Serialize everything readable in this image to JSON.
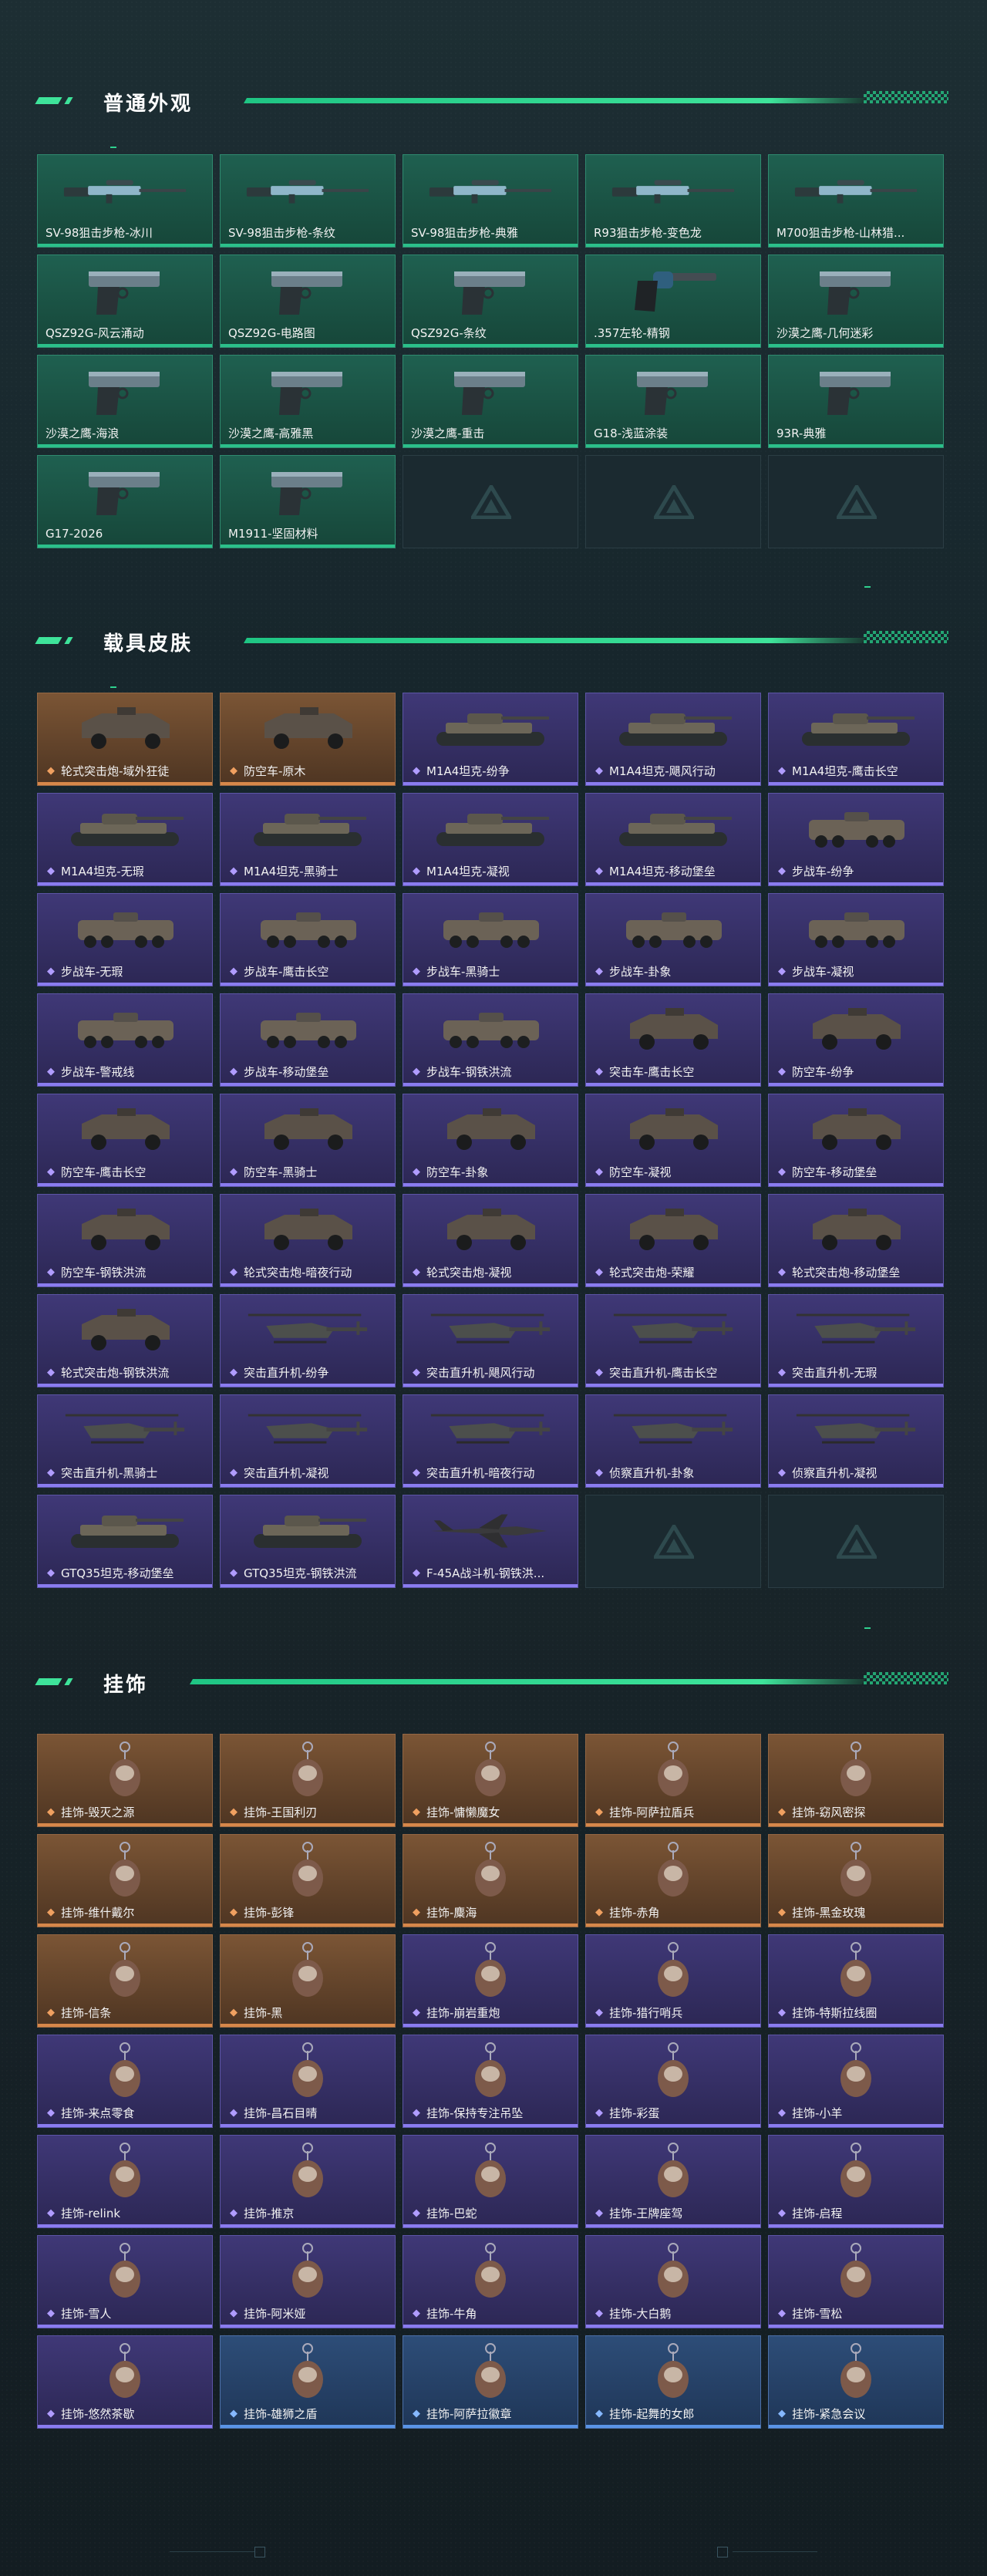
{
  "colors": {
    "green": "#2bc08a",
    "orange": "#d7874a",
    "purple": "#8a7cf0",
    "blue": "#5a94e6",
    "accent": "#3ee39a"
  },
  "sections": [
    {
      "title": "普通外观",
      "items": [
        {
          "label": "SV-98狙击步枪-冰川",
          "tier": "green",
          "icon": "sniper-rifle-icon"
        },
        {
          "label": "SV-98狙击步枪-条纹",
          "tier": "green",
          "icon": "sniper-rifle-icon"
        },
        {
          "label": "SV-98狙击步枪-典雅",
          "tier": "green",
          "icon": "sniper-rifle-icon"
        },
        {
          "label": "R93狙击步枪-变色龙",
          "tier": "green",
          "icon": "sniper-rifle-icon"
        },
        {
          "label": "M700狙击步枪-山林猎...",
          "tier": "green",
          "icon": "sniper-rifle-icon"
        },
        {
          "label": "QSZ92G-风云涌动",
          "tier": "green",
          "icon": "pistol-icon"
        },
        {
          "label": "QSZ92G-电路图",
          "tier": "green",
          "icon": "pistol-icon"
        },
        {
          "label": "QSZ92G-条纹",
          "tier": "green",
          "icon": "pistol-icon"
        },
        {
          "label": ".357左轮-精钢",
          "tier": "green",
          "icon": "revolver-icon"
        },
        {
          "label": "沙漠之鹰-几何迷彩",
          "tier": "green",
          "icon": "pistol-icon"
        },
        {
          "label": "沙漠之鹰-海浪",
          "tier": "green",
          "icon": "pistol-icon"
        },
        {
          "label": "沙漠之鹰-高雅黑",
          "tier": "green",
          "icon": "pistol-icon"
        },
        {
          "label": "沙漠之鹰-重击",
          "tier": "green",
          "icon": "pistol-icon"
        },
        {
          "label": "G18-浅蓝涂装",
          "tier": "green",
          "icon": "pistol-icon"
        },
        {
          "label": "93R-典雅",
          "tier": "green",
          "icon": "pistol-icon"
        },
        {
          "label": "G17-2026",
          "tier": "green",
          "icon": "pistol-icon"
        },
        {
          "label": "M1911-坚固材料",
          "tier": "green",
          "icon": "pistol-icon"
        },
        {
          "label": "",
          "tier": "empty",
          "icon": "empty-slot-logo-icon"
        },
        {
          "label": "",
          "tier": "empty",
          "icon": "empty-slot-logo-icon"
        },
        {
          "label": "",
          "tier": "empty",
          "icon": "empty-slot-logo-icon"
        }
      ]
    },
    {
      "title": "载具皮肤",
      "items": [
        {
          "label": "轮式突击炮-域外狂徒",
          "tier": "orange",
          "icon": "armored-car-icon"
        },
        {
          "label": "防空车-原木",
          "tier": "orange",
          "icon": "armored-car-icon"
        },
        {
          "label": "M1A4坦克-纷争",
          "tier": "purple",
          "icon": "tank-icon"
        },
        {
          "label": "M1A4坦克-飓风行动",
          "tier": "purple",
          "icon": "tank-icon"
        },
        {
          "label": "M1A4坦克-鹰击长空",
          "tier": "purple",
          "icon": "tank-icon"
        },
        {
          "label": "M1A4坦克-无瑕",
          "tier": "purple",
          "icon": "tank-icon"
        },
        {
          "label": "M1A4坦克-黑骑士",
          "tier": "purple",
          "icon": "tank-icon"
        },
        {
          "label": "M1A4坦克-凝视",
          "tier": "purple",
          "icon": "tank-icon"
        },
        {
          "label": "M1A4坦克-移动堡垒",
          "tier": "purple",
          "icon": "tank-icon"
        },
        {
          "label": "步战车-纷争",
          "tier": "purple",
          "icon": "ifv-icon"
        },
        {
          "label": "步战车-无瑕",
          "tier": "purple",
          "icon": "ifv-icon"
        },
        {
          "label": "步战车-鹰击长空",
          "tier": "purple",
          "icon": "ifv-icon"
        },
        {
          "label": "步战车-黑骑士",
          "tier": "purple",
          "icon": "ifv-icon"
        },
        {
          "label": "步战车-卦象",
          "tier": "purple",
          "icon": "ifv-icon"
        },
        {
          "label": "步战车-凝视",
          "tier": "purple",
          "icon": "ifv-icon"
        },
        {
          "label": "步战车-警戒线",
          "tier": "purple",
          "icon": "ifv-icon"
        },
        {
          "label": "步战车-移动堡垒",
          "tier": "purple",
          "icon": "ifv-icon"
        },
        {
          "label": "步战车-钢铁洪流",
          "tier": "purple",
          "icon": "ifv-icon"
        },
        {
          "label": "突击车-鹰击长空",
          "tier": "purple",
          "icon": "armored-car-icon"
        },
        {
          "label": "防空车-纷争",
          "tier": "purple",
          "icon": "armored-car-icon"
        },
        {
          "label": "防空车-鹰击长空",
          "tier": "purple",
          "icon": "armored-car-icon"
        },
        {
          "label": "防空车-黑骑士",
          "tier": "purple",
          "icon": "armored-car-icon"
        },
        {
          "label": "防空车-卦象",
          "tier": "purple",
          "icon": "armored-car-icon"
        },
        {
          "label": "防空车-凝视",
          "tier": "purple",
          "icon": "armored-car-icon"
        },
        {
          "label": "防空车-移动堡垒",
          "tier": "purple",
          "icon": "armored-car-icon"
        },
        {
          "label": "防空车-钢铁洪流",
          "tier": "purple",
          "icon": "armored-car-icon"
        },
        {
          "label": "轮式突击炮-暗夜行动",
          "tier": "purple",
          "icon": "armored-car-icon"
        },
        {
          "label": "轮式突击炮-凝视",
          "tier": "purple",
          "icon": "armored-car-icon"
        },
        {
          "label": "轮式突击炮-荣耀",
          "tier": "purple",
          "icon": "armored-car-icon"
        },
        {
          "label": "轮式突击炮-移动堡垒",
          "tier": "purple",
          "icon": "armored-car-icon"
        },
        {
          "label": "轮式突击炮-钢铁洪流",
          "tier": "purple",
          "icon": "armored-car-icon"
        },
        {
          "label": "突击直升机-纷争",
          "tier": "purple",
          "icon": "helicopter-icon"
        },
        {
          "label": "突击直升机-飓风行动",
          "tier": "purple",
          "icon": "helicopter-icon"
        },
        {
          "label": "突击直升机-鹰击长空",
          "tier": "purple",
          "icon": "helicopter-icon"
        },
        {
          "label": "突击直升机-无瑕",
          "tier": "purple",
          "icon": "helicopter-icon"
        },
        {
          "label": "突击直升机-黑骑士",
          "tier": "purple",
          "icon": "helicopter-icon"
        },
        {
          "label": "突击直升机-凝视",
          "tier": "purple",
          "icon": "helicopter-icon"
        },
        {
          "label": "突击直升机-暗夜行动",
          "tier": "purple",
          "icon": "helicopter-icon"
        },
        {
          "label": "侦察直升机-卦象",
          "tier": "purple",
          "icon": "helicopter-icon"
        },
        {
          "label": "侦察直升机-凝视",
          "tier": "purple",
          "icon": "helicopter-icon"
        },
        {
          "label": "GTQ35坦克-移动堡垒",
          "tier": "purple",
          "icon": "tank-icon"
        },
        {
          "label": "GTQ35坦克-钢铁洪流",
          "tier": "purple",
          "icon": "tank-icon"
        },
        {
          "label": "F-45A战斗机-钢铁洪...",
          "tier": "purple",
          "icon": "fighter-jet-icon"
        },
        {
          "label": "",
          "tier": "empty",
          "icon": "empty-slot-logo-icon"
        },
        {
          "label": "",
          "tier": "empty",
          "icon": "empty-slot-logo-icon"
        }
      ]
    },
    {
      "title": "挂饰",
      "items": [
        {
          "label": "挂饰-毁灭之源",
          "tier": "orange",
          "icon": "charm-icon"
        },
        {
          "label": "挂饰-王国利刃",
          "tier": "orange",
          "icon": "charm-icon"
        },
        {
          "label": "挂饰-慵懒魔女",
          "tier": "orange",
          "icon": "charm-icon"
        },
        {
          "label": "挂饰-阿萨拉盾兵",
          "tier": "orange",
          "icon": "charm-icon"
        },
        {
          "label": "挂饰-窈风密探",
          "tier": "orange",
          "icon": "charm-icon"
        },
        {
          "label": "挂饰-维什戴尔",
          "tier": "orange",
          "icon": "charm-icon"
        },
        {
          "label": "挂饰-彭锋",
          "tier": "orange",
          "icon": "charm-icon"
        },
        {
          "label": "挂饰-麋海",
          "tier": "orange",
          "icon": "charm-icon"
        },
        {
          "label": "挂饰-赤角",
          "tier": "orange",
          "icon": "charm-icon"
        },
        {
          "label": "挂饰-黑金玫瑰",
          "tier": "orange",
          "icon": "charm-icon"
        },
        {
          "label": "挂饰-信条",
          "tier": "orange",
          "icon": "charm-icon"
        },
        {
          "label": "挂饰-黑",
          "tier": "orange",
          "icon": "charm-icon"
        },
        {
          "label": "挂饰-崩岩重炮",
          "tier": "purple",
          "icon": "charm-icon"
        },
        {
          "label": "挂饰-猎行哨兵",
          "tier": "purple",
          "icon": "charm-icon"
        },
        {
          "label": "挂饰-特斯拉线圈",
          "tier": "purple",
          "icon": "charm-icon"
        },
        {
          "label": "挂饰-来点零食",
          "tier": "purple",
          "icon": "charm-icon"
        },
        {
          "label": "挂饰-昌石目晴",
          "tier": "purple",
          "icon": "charm-icon"
        },
        {
          "label": "挂饰-保持专注吊坠",
          "tier": "purple",
          "icon": "charm-icon"
        },
        {
          "label": "挂饰-彩蛋",
          "tier": "purple",
          "icon": "charm-icon"
        },
        {
          "label": "挂饰-小羊",
          "tier": "purple",
          "icon": "charm-icon"
        },
        {
          "label": "挂饰-relink",
          "tier": "purple",
          "icon": "charm-icon"
        },
        {
          "label": "挂饰-推京",
          "tier": "purple",
          "icon": "charm-icon"
        },
        {
          "label": "挂饰-巴蛇",
          "tier": "purple",
          "icon": "charm-icon"
        },
        {
          "label": "挂饰-王牌座驾",
          "tier": "purple",
          "icon": "charm-icon"
        },
        {
          "label": "挂饰-启程",
          "tier": "purple",
          "icon": "charm-icon"
        },
        {
          "label": "挂饰-雪人",
          "tier": "purple",
          "icon": "charm-icon"
        },
        {
          "label": "挂饰-阿米娅",
          "tier": "purple",
          "icon": "charm-icon"
        },
        {
          "label": "挂饰-牛角",
          "tier": "purple",
          "icon": "charm-icon"
        },
        {
          "label": "挂饰-大白鹅",
          "tier": "purple",
          "icon": "charm-icon"
        },
        {
          "label": "挂饰-雪松",
          "tier": "purple",
          "icon": "charm-icon"
        },
        {
          "label": "挂饰-悠然茶歇",
          "tier": "purple",
          "icon": "charm-icon"
        },
        {
          "label": "挂饰-雄狮之盾",
          "tier": "blue",
          "icon": "charm-icon"
        },
        {
          "label": "挂饰-阿萨拉徽章",
          "tier": "blue",
          "icon": "charm-icon"
        },
        {
          "label": "挂饰-起舞的女郎",
          "tier": "blue",
          "icon": "charm-icon"
        },
        {
          "label": "挂饰-紧急会议",
          "tier": "blue",
          "icon": "charm-icon"
        }
      ]
    }
  ]
}
